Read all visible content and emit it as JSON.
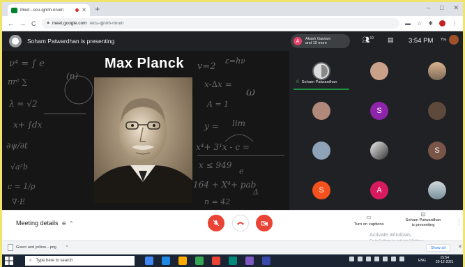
{
  "browser": {
    "tab_title": "Meet - ecu-qjnnh-nnum",
    "url_host": "meet.google.com",
    "url_path": "/ecu-qjnnh-nnum"
  },
  "meet": {
    "presenting_text": "Soham Patwardhan is presenting",
    "participants_pill": {
      "initial": "A",
      "line1": "Akash Gautam",
      "line2": "and 10 more"
    },
    "participant_count": "10",
    "clock": "3:54 PM",
    "you_label": "You"
  },
  "slide": {
    "title": "Max Planck"
  },
  "participants": {
    "active_name": "Soham Patwardhan",
    "initials": {
      "s1": "S",
      "s2": "S",
      "s3": "S",
      "a": "A"
    },
    "colors": {
      "purple": "#8e24aa",
      "brown": "#795548",
      "orange": "#f4511e",
      "pink": "#d81b60"
    }
  },
  "controls": {
    "meeting_details": "Meeting details",
    "captions": "Turn on captions",
    "presenter_line1": "Soham Patwardhan",
    "presenter_line2": "is presenting",
    "activate_title": "Activate Windows",
    "activate_sub": "Go to Settings to activate Windows."
  },
  "download": {
    "filename": "Green and yellow....png",
    "show_all": "Show all"
  },
  "taskbar": {
    "search_placeholder": "Type here to search",
    "lang": "ENG",
    "time": "15:54",
    "date": "20-12-2021"
  },
  "colors": {
    "meet_bg": "#202124",
    "end_red": "#ea4335",
    "active_green": "#1e8e3e"
  }
}
